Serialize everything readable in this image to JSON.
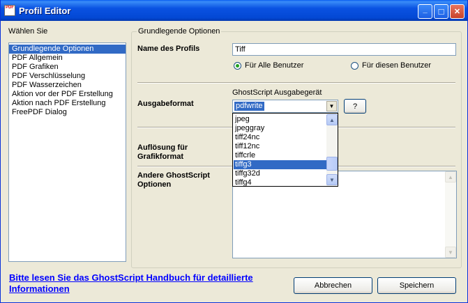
{
  "window": {
    "title": "Profil Editor",
    "app_icon_text": "PDF",
    "minimize_glyph": "_",
    "maximize_glyph": "□",
    "close_glyph": "✕"
  },
  "sidebar": {
    "caption": "Wählen Sie",
    "items": [
      {
        "label": "Grundlegende Optionen",
        "selected": true
      },
      {
        "label": "PDF Allgemein"
      },
      {
        "label": "PDF Grafiken"
      },
      {
        "label": "PDF Verschlüsselung"
      },
      {
        "label": "PDF Wasserzeichen"
      },
      {
        "label": "Aktion vor der PDF Erstellung"
      },
      {
        "label": "Aktion nach PDF Erstellung"
      },
      {
        "label": "FreePDF Dialog"
      }
    ]
  },
  "main": {
    "group_caption": "Grundlegende Optionen",
    "profile_name_label": "Name des Profils",
    "profile_name_value": "Tiff",
    "radio_all_users": "Für Alle Benutzer",
    "radio_this_user": "Für diesen Benutzer",
    "radio_selected": "all",
    "device_caption": "GhostScript Ausgabegerät",
    "output_format_label": "Ausgabeformat",
    "device_value": "pdfwrite",
    "help_button": "?",
    "resolution_label": "Auflösung für Grafikformat",
    "other_options_label": "Andere GhostScript Optionen",
    "other_options_value": ""
  },
  "dropdown": {
    "options": [
      "jpeg",
      "jpeggray",
      "tiff24nc",
      "tiff12nc",
      "tiffcrle",
      "tiffg3",
      "tiffg32d",
      "tiffg4"
    ],
    "highlighted": "tiffg3",
    "scroll_up": "▲",
    "scroll_down": "▼"
  },
  "footer": {
    "help_link": "Bitte lesen Sie das GhostScript Handbuch für detaillierte Informationen",
    "cancel_button": "Abbrechen",
    "save_button": "Speichern"
  }
}
